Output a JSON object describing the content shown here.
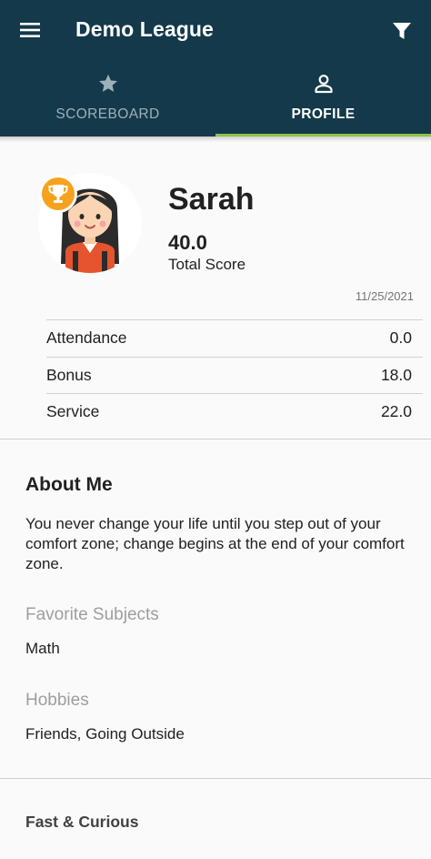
{
  "appbar": {
    "title": "Demo League",
    "background_color": "#13394b",
    "menu_icon": "menu-icon",
    "filter_icon": "filter-icon"
  },
  "tabs": [
    {
      "label": "SCOREBOARD",
      "icon": "star-icon",
      "active": false
    },
    {
      "label": "PROFILE",
      "icon": "person-icon",
      "active": true
    }
  ],
  "tab_indicator_color": "#8bc34a",
  "profile": {
    "name": "Sarah",
    "score": "40.0",
    "score_label": "Total Score",
    "date": "11/25/2021",
    "avatar_icon": "girl-avatar-icon",
    "badge_icon": "trophy-icon",
    "badge_color": "#f6a21e"
  },
  "stats": [
    {
      "label": "Attendance",
      "value": "0.0"
    },
    {
      "label": "Bonus",
      "value": "18.0"
    },
    {
      "label": "Service",
      "value": "22.0"
    }
  ],
  "about": {
    "title": "About Me",
    "text": "You never change your life until you step out of your comfort zone; change begins at the end of your comfort zone.",
    "favorite_subjects_label": "Favorite Subjects",
    "favorite_subjects": "Math",
    "hobbies_label": "Hobbies",
    "hobbies": "Friends, Going Outside"
  },
  "footer": {
    "title": "Fast & Curious"
  }
}
